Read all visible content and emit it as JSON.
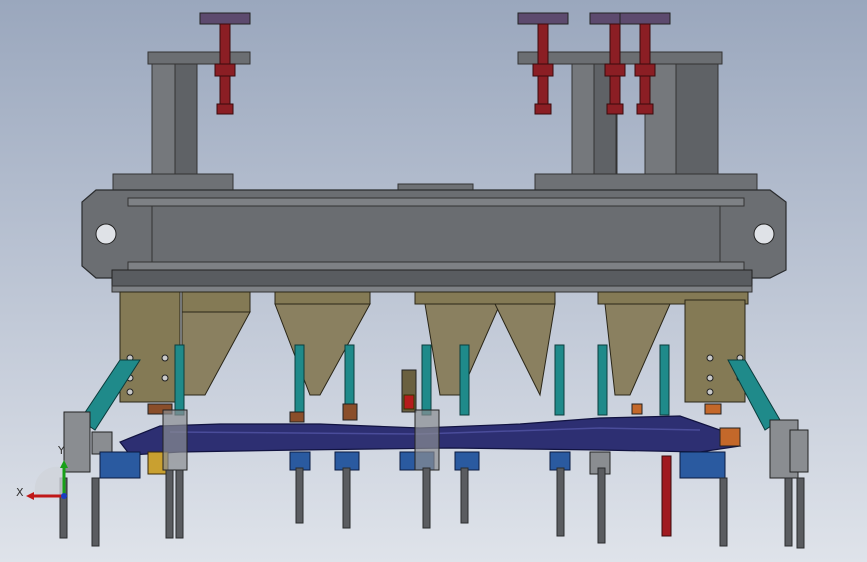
{
  "viewport": {
    "background_top": "#9aa7bd",
    "background_bottom": "#dfe3ea"
  },
  "model": {
    "frame_color": "#6b6e72",
    "frame_dark": "#4a4d50",
    "frame_light": "#8a8d91",
    "bracket_color": "#847a55",
    "teal_color": "#1f8a8a",
    "part_color": "#2d2f72",
    "screw_color": "#8b1e24",
    "pad_color": "#5d4a6e",
    "pin_color": "#5a5c60",
    "accent_orange": "#c4682a"
  },
  "triad": {
    "x_label": "X",
    "y_label": "Y",
    "x_color": "#c01818",
    "y_color": "#18a018",
    "z_color": "#1a3cc0"
  }
}
